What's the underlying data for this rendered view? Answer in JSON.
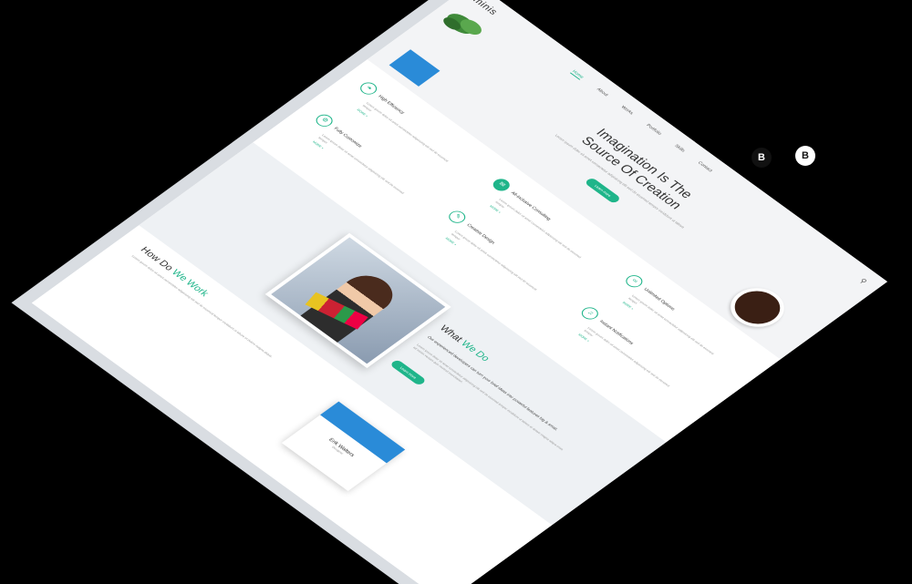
{
  "brand": {
    "logo": "minis",
    "accent": "#1fb58a"
  },
  "nav": {
    "items": [
      "Home",
      "About",
      "Works",
      "Portfolio",
      "Skills",
      "Contact"
    ],
    "active_index": 0
  },
  "hero": {
    "title_line1": "Imagination Is The",
    "title_line2": "Source Of Creation",
    "subtitle": "Lorem ipsum dolor sit amet consectetur adipisicing elit sed do eiusmod tempor incididunt ut labore",
    "button": "Learn more"
  },
  "features": [
    {
      "title": "High Efficiency",
      "icon": "leaf-icon",
      "filled": false,
      "more": "MORE +"
    },
    {
      "title": "All-inclusive Consulting",
      "icon": "chat-icon",
      "filled": true,
      "more": "MORE +"
    },
    {
      "title": "Fully Customize",
      "icon": "settings-icon",
      "filled": false,
      "more": "MORE +"
    },
    {
      "title": "Creative Design",
      "icon": "pen-icon",
      "filled": false,
      "more": "MORE +"
    },
    {
      "title": "Instant Notifications",
      "icon": "bell-icon",
      "filled": false,
      "more": "MORE +"
    },
    {
      "title": "Unlimited Options",
      "icon": "infinity-icon",
      "filled": false,
      "more": "MORE +"
    }
  ],
  "feature_desc": "Lorem ipsum dolor sit amet consectetur adipisicing elit sed do eiusmod tempor",
  "what_we_do": {
    "title_a": "What ",
    "title_b": "We Do",
    "lead": "Our experienced developers can turn your brief ideas into powerful features big & small.",
    "text": "Lorem ipsum dolor sit amet consectetur adipisicing elit sed do eiusmod tempor incididunt ut labore et dolore magna aliqua enim ad minim veniam quis nostrud exercitation.",
    "button": "Learn more"
  },
  "how_we_work": {
    "title_a": "How Do ",
    "title_b": "We Work",
    "text": "Lorem ipsum dolor sit amet consectetur adipisicing elit sed do eiusmod tempor incididunt ut labore et dolore magna aliqua."
  },
  "profile_card": {
    "name": "Erik Walters",
    "role": "Designer"
  },
  "badges": [
    {
      "label": "B",
      "color": "#111"
    },
    {
      "label": "B",
      "color": "#fff"
    }
  ]
}
